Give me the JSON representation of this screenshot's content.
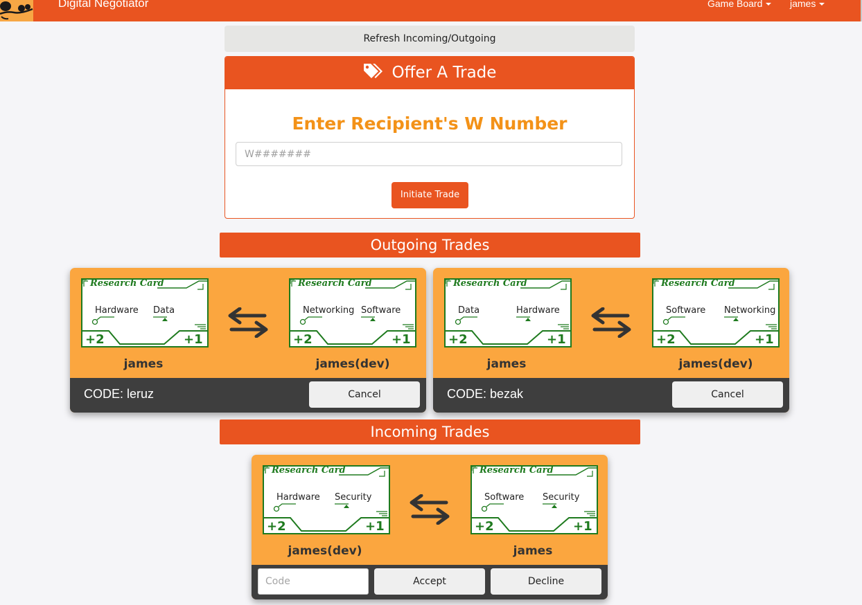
{
  "navbar": {
    "brand": "Digital Negotiator",
    "game_board": "Game Board",
    "user": "james"
  },
  "refresh_label": "Refresh Incoming/Outgoing",
  "offer": {
    "title": "Offer A Trade",
    "recipient_label": "Enter Recipient's W Number",
    "placeholder": "W#######",
    "initiate_label": "Initiate Trade"
  },
  "card_title": "Research Card",
  "outgoing": {
    "title": "Outgoing Trades",
    "trades": [
      {
        "left_card": {
          "field1": "Hardware",
          "field2": "Data",
          "bonus_left": "+2",
          "bonus_right": "+1"
        },
        "left_owner": "james",
        "right_card": {
          "field1": "Networking",
          "field2": "Software",
          "bonus_left": "+2",
          "bonus_right": "+1"
        },
        "right_owner": "james(dev)",
        "code": "CODE: leruz",
        "cancel_label": "Cancel"
      },
      {
        "left_card": {
          "field1": "Data",
          "field2": "Hardware",
          "bonus_left": "+2",
          "bonus_right": "+1"
        },
        "left_owner": "james",
        "right_card": {
          "field1": "Software",
          "field2": "Networking",
          "bonus_left": "+2",
          "bonus_right": "+1"
        },
        "right_owner": "james(dev)",
        "code": "CODE: bezak",
        "cancel_label": "Cancel"
      }
    ]
  },
  "incoming": {
    "title": "Incoming Trades",
    "trades": [
      {
        "left_card": {
          "field1": "Hardware",
          "field2": "Security",
          "bonus_left": "+2",
          "bonus_right": "+1"
        },
        "left_owner": "james(dev)",
        "right_card": {
          "field1": "Software",
          "field2": "Security",
          "bonus_left": "+2",
          "bonus_right": "+1"
        },
        "right_owner": "james",
        "code_placeholder": "Code",
        "accept_label": "Accept",
        "decline_label": "Decline"
      }
    ]
  },
  "colors": {
    "primary": "#e95420",
    "trade_bg": "#fba63f",
    "card_green": "#1e7a1e",
    "footer_dark": "#3e3e3e",
    "recipient_label": "#f39218"
  },
  "icons": {
    "offer_title": "tags-icon",
    "trade_swap": "exchange-arrows-icon",
    "nav_dropdown": "caret-down-icon"
  }
}
